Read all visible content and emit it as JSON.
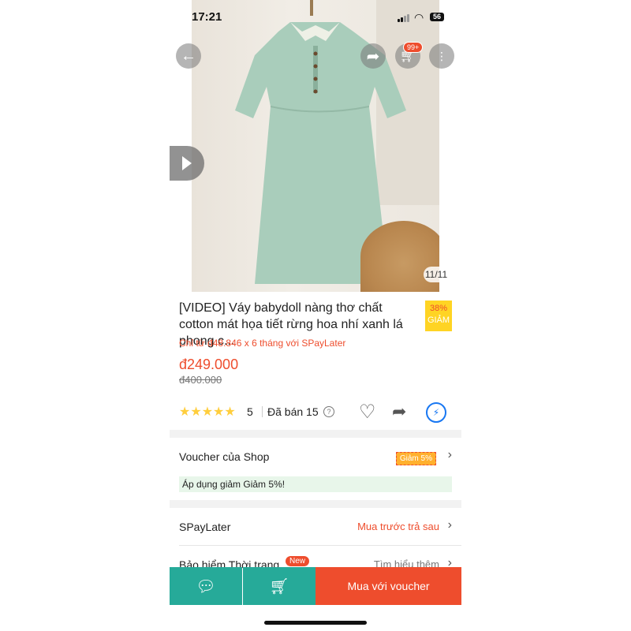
{
  "status_bar": {
    "time": "17:21",
    "battery": "56"
  },
  "hero": {
    "cart_badge": "99+",
    "image_counter": "11/11"
  },
  "product": {
    "title": "[VIDEO] Váy babydoll nàng thơ chất cotton mát họa tiết rừng hoa nhí xanh lá phong c...",
    "discount_percent": "38%",
    "discount_label": "GIẢM",
    "spaylater_note": "Chỉ từ đ48.846 x 6 tháng với SPayLater",
    "price": "đ249.000",
    "original_price": "đ400.000",
    "rating": "5",
    "rating_stars": 5,
    "sold": "Đã bán 15"
  },
  "voucher": {
    "label": "Voucher của Shop",
    "tag": "Giảm 5%",
    "apply_text": "Áp dụng giảm Giảm 5%!"
  },
  "spaylater": {
    "label": "SPayLater",
    "action": "Mua trước trả sau"
  },
  "insurance": {
    "label": "Bảo hiểm Thời trang",
    "badge": "New",
    "action": "Tìm hiểu thêm"
  },
  "bottom_bar": {
    "buy_label": "Mua với voucher"
  },
  "colors": {
    "accent": "#ee4d2d",
    "teal": "#26aa99",
    "star": "#ffce3d"
  },
  "icons": [
    "back-icon",
    "share-icon",
    "cart-icon",
    "more-icon",
    "play-icon",
    "heart-icon",
    "messenger-icon",
    "chat-icon",
    "add-to-cart-icon",
    "chevron-right-icon"
  ]
}
